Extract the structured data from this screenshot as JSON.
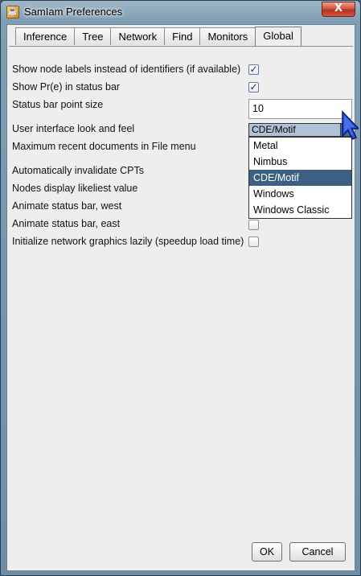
{
  "window": {
    "title": "SamIam Preferences",
    "close_label": "X"
  },
  "tabs": [
    {
      "label": "Inference"
    },
    {
      "label": "Tree"
    },
    {
      "label": "Network"
    },
    {
      "label": "Find"
    },
    {
      "label": "Monitors"
    },
    {
      "label": "Global",
      "active": true
    }
  ],
  "settings": {
    "show_node_labels": {
      "label": "Show node labels instead of identifiers (if available)",
      "checked": true
    },
    "show_pr_e": {
      "label": "Show Pr(e) in status bar",
      "checked": true
    },
    "status_point_size": {
      "label": "Status bar point size",
      "value": "10"
    },
    "look_and_feel": {
      "label": "User interface look and feel",
      "value": "CDE/Motif",
      "options": [
        "Metal",
        "Nimbus",
        "CDE/Motif",
        "Windows",
        "Windows Classic"
      ]
    },
    "max_recent_docs": {
      "label": "Maximum recent documents in File menu"
    },
    "auto_invalidate_cpts": {
      "label": "Automatically invalidate CPTs"
    },
    "nodes_display_likeliest": {
      "label": "Nodes display likeliest value"
    },
    "animate_west": {
      "label": "Animate status bar, west",
      "checked": false
    },
    "animate_east": {
      "label": "Animate status bar, east",
      "checked": false
    },
    "init_lazily": {
      "label": "Initialize network graphics lazily (speedup load time)",
      "checked": false
    }
  },
  "buttons": {
    "ok": "OK",
    "cancel": "Cancel"
  },
  "icons": {
    "app": "java-cup-icon",
    "cursor": "arrow-cursor-icon"
  },
  "colors": {
    "selection": "#3b6084",
    "combo_bg": "#b0c3d6",
    "close_red": "#c9412b"
  }
}
